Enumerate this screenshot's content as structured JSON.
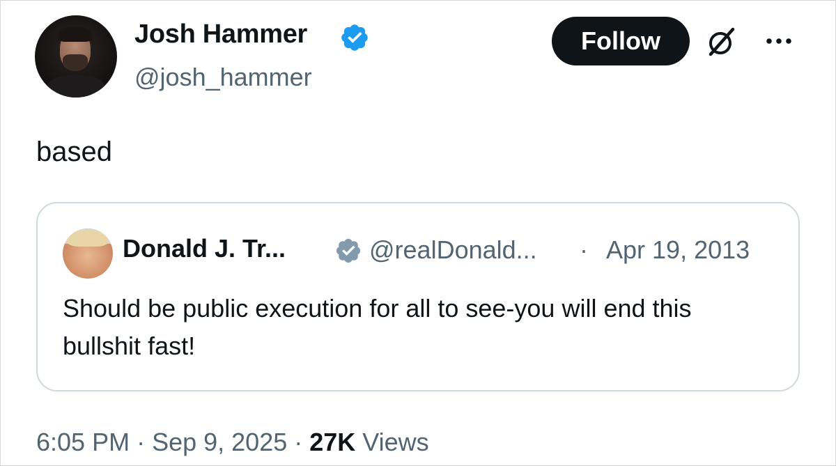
{
  "author": {
    "name": "Josh Hammer",
    "handle": "@josh_hammer",
    "verified_color": "#1d9bf0"
  },
  "actions": {
    "follow_label": "Follow",
    "grok_icon": "grok-icon",
    "more_icon": "more-icon"
  },
  "tweet": {
    "text": "based"
  },
  "quoted": {
    "name": "Donald J. Tr...",
    "handle": "@realDonald...",
    "separator": "·",
    "date": "Apr 19, 2013",
    "verified_color": "#829aab",
    "text": "Should be public execution for all to see-you will end this bullshit fast!"
  },
  "meta": {
    "time": "6:05 PM",
    "sep1": " · ",
    "date": "Sep 9, 2025",
    "sep2": " · ",
    "views_count": "27K",
    "views_label": " Views"
  }
}
